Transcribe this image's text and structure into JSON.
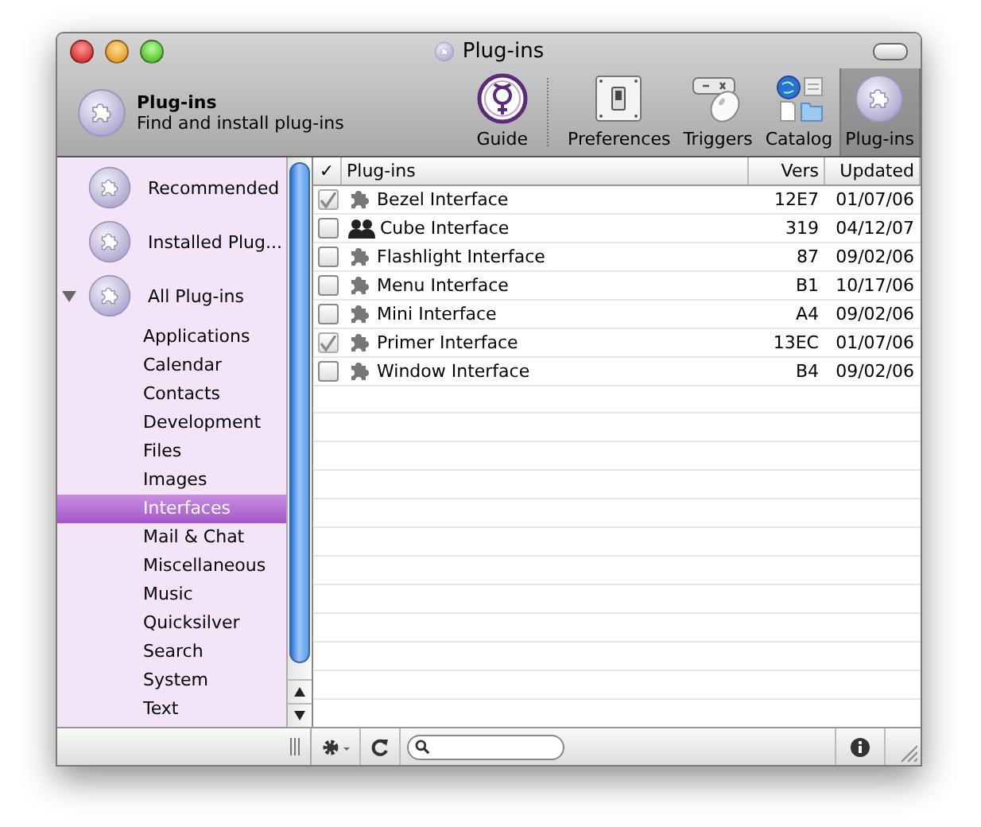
{
  "window": {
    "title": "Plug-ins"
  },
  "header": {
    "title": "Plug-ins",
    "subtitle": "Find and install plug-ins"
  },
  "toolbar": [
    {
      "label": "Guide",
      "kind": "guide",
      "selected": false
    },
    {
      "label": "Preferences",
      "kind": "preferences",
      "selected": false
    },
    {
      "label": "Triggers",
      "kind": "triggers",
      "selected": false
    },
    {
      "label": "Catalog",
      "kind": "catalog",
      "selected": false
    },
    {
      "label": "Plug-ins",
      "kind": "plugins",
      "selected": true
    }
  ],
  "sidebar": {
    "items": [
      {
        "label": "Recommended",
        "selected": false
      },
      {
        "label": "Installed Plug...",
        "selected": false
      },
      {
        "label": "All Plug-ins",
        "selected": false,
        "expanded": true,
        "children": [
          {
            "label": "Applications",
            "selected": false
          },
          {
            "label": "Calendar",
            "selected": false
          },
          {
            "label": "Contacts",
            "selected": false
          },
          {
            "label": "Development",
            "selected": false
          },
          {
            "label": "Files",
            "selected": false
          },
          {
            "label": "Images",
            "selected": false
          },
          {
            "label": "Interfaces",
            "selected": true
          },
          {
            "label": "Mail & Chat",
            "selected": false
          },
          {
            "label": "Miscellaneous",
            "selected": false
          },
          {
            "label": "Music",
            "selected": false
          },
          {
            "label": "Quicksilver",
            "selected": false
          },
          {
            "label": "Search",
            "selected": false
          },
          {
            "label": "System",
            "selected": false
          },
          {
            "label": "Text",
            "selected": false
          }
        ]
      }
    ]
  },
  "table": {
    "columns": [
      "✓",
      "Plug-ins",
      "Vers",
      "Updated"
    ],
    "rows": [
      {
        "checked": true,
        "kind": "plugin",
        "name": "Bezel Interface",
        "version": "12E7",
        "updated": "01/07/06"
      },
      {
        "checked": false,
        "kind": "people",
        "name": "Cube Interface",
        "version": "319",
        "updated": "04/12/07"
      },
      {
        "checked": false,
        "kind": "plugin",
        "name": "Flashlight Interface",
        "version": "87",
        "updated": "09/02/06"
      },
      {
        "checked": false,
        "kind": "plugin",
        "name": "Menu Interface",
        "version": "B1",
        "updated": "10/17/06"
      },
      {
        "checked": false,
        "kind": "plugin",
        "name": "Mini Interface",
        "version": "A4",
        "updated": "09/02/06"
      },
      {
        "checked": true,
        "kind": "plugin",
        "name": "Primer Interface",
        "version": "13EC",
        "updated": "01/07/06"
      },
      {
        "checked": false,
        "kind": "plugin",
        "name": "Window Interface",
        "version": "B4",
        "updated": "09/02/06"
      }
    ]
  }
}
